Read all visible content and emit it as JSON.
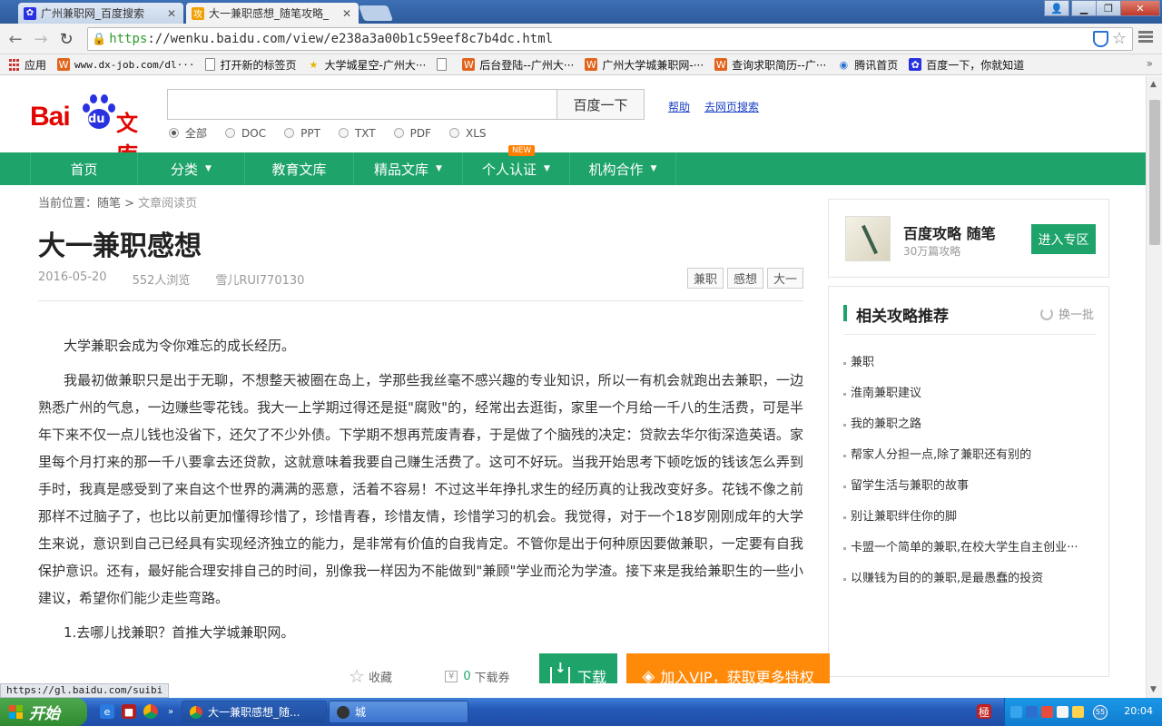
{
  "browser": {
    "tabs": [
      {
        "title": "广州兼职网_百度搜索",
        "icon": "baidu-paw-icon"
      },
      {
        "title": "大一兼职感想_随笔攻略_",
        "icon": "baidu-wenku-icon"
      }
    ],
    "url_scheme": "https",
    "url_rest": "://wenku.baidu.com/view/e238a3a00b1c59eef8c7b4dc.html",
    "bookmarks": [
      {
        "label": "应用",
        "icon": "apps-icon"
      },
      {
        "label": "www.dx-job.com/dl···",
        "icon": "dxjob-icon"
      },
      {
        "label": "打开新的标签页",
        "icon": "page-icon"
      },
      {
        "label": "大学城星空-广州大···",
        "icon": "star-icon"
      },
      {
        "label": "",
        "icon": "page-icon"
      },
      {
        "label": "后台登陆--广州大···",
        "icon": "dxjob-icon"
      },
      {
        "label": "广州大学城兼职网-···",
        "icon": "dxjob-icon"
      },
      {
        "label": "查询求职简历--广···",
        "icon": "dxjob-icon"
      },
      {
        "label": "腾讯首页",
        "icon": "qq-icon"
      },
      {
        "label": "百度一下，你就知道",
        "icon": "baidu-icon"
      }
    ],
    "status_url": "https://gl.baidu.com/suibi"
  },
  "header": {
    "logo_text_bai": "Bai",
    "logo_text_du": "du",
    "logo_text_wenku": "文库",
    "search_button": "百度一下",
    "help_link": "帮助",
    "web_search_link": "去网页搜索",
    "file_types": [
      {
        "label": "全部",
        "selected": true
      },
      {
        "label": "DOC",
        "selected": false
      },
      {
        "label": "PPT",
        "selected": false
      },
      {
        "label": "TXT",
        "selected": false
      },
      {
        "label": "PDF",
        "selected": false
      },
      {
        "label": "XLS",
        "selected": false
      }
    ]
  },
  "green_nav": {
    "items": [
      {
        "label": "首页",
        "dropdown": false
      },
      {
        "label": "分类",
        "dropdown": true
      },
      {
        "label": "教育文库",
        "dropdown": false
      },
      {
        "label": "精品文库",
        "dropdown": true
      },
      {
        "label": "个人认证",
        "dropdown": true
      },
      {
        "label": "机构合作",
        "dropdown": true
      }
    ],
    "new_badge": "NEW"
  },
  "article": {
    "breadcrumb_prefix": "当前位置：随笔 >",
    "breadcrumb_current": "文章阅读页",
    "title": "大一兼职感想",
    "date": "2016-05-20",
    "views": "552人浏览",
    "author": "雪儿RUI770130",
    "tags": [
      "兼职",
      "感想",
      "大一"
    ],
    "paragraphs": [
      "大学兼职会成为令你难忘的成长经历。",
      "我最初做兼职只是出于无聊，不想整天被圈在岛上，学那些我丝毫不感兴趣的专业知识，所以一有机会就跑出去兼职，一边熟悉广州的气息，一边赚些零花钱。我大一上学期过得还是挺\"腐败\"的，经常出去逛街，家里一个月给一千八的生活费，可是半年下来不仅一点儿钱也没省下，还欠了不少外债。下学期不想再荒废青春，于是做了个脑残的决定：贷款去华尔街深造英语。家里每个月打来的那一千八要拿去还贷款，这就意味着我要自己赚生活费了。这可不好玩。当我开始思考下顿吃饭的钱该怎么弄到手时，我真是感受到了来自这个世界的满满的恶意，活着不容易！不过这半年挣扎求生的经历真的让我改变好多。花钱不像之前那样不过脑子了，也比以前更加懂得珍惜了，珍惜青春，珍惜友情，珍惜学习的机会。我觉得，对于一个18岁刚刚成年的大学生来说，意识到自己已经具有实现经济独立的能力，是非常有价值的自我肯定。不管你是出于何种原因要做兼职，一定要有自我保护意识。还有，最好能合理安排自己的时间，别像我一样因为不能做到\"兼顾\"学业而沦为学渣。接下来是我给兼职生的一些小建议，希望你们能少走些弯路。",
      "1.去哪儿找兼职？首推大学城兼职网。"
    ]
  },
  "sidebar": {
    "zone_name": "百度攻略  随笔",
    "zone_sub": "30万篇攻略",
    "zone_button": "进入专区",
    "rec_title": "相关攻略推荐",
    "rec_refresh": "换一批",
    "rec_items": [
      "兼职",
      "淮南兼职建议",
      "我的兼职之路",
      "帮家人分担一点,除了兼职还有别的",
      "留学生活与兼职的故事",
      "别让兼职绊住你的脚",
      "卡盟一个简单的兼职,在校大学生自主创业···",
      "以赚钱为目的的兼职,是最愚蠢的投资"
    ]
  },
  "bottom_bar": {
    "favorite": "收藏",
    "coupon_count": "0",
    "coupon_label": "下载券",
    "download": "下载",
    "vip": "加入VIP，获取更多特权"
  },
  "taskbar": {
    "start": "开始",
    "tasks": [
      {
        "label": "大一兼职感想_随...",
        "icon": "chrome-icon"
      },
      {
        "label": "城",
        "icon": "app-icon"
      }
    ],
    "tray_badge": "55",
    "clock": "20:04"
  },
  "colors": {
    "baidu_red": "#e10601",
    "baidu_blue": "#2932e1",
    "wenku_green": "#1ea36a",
    "vip_orange": "#ff8a0a"
  }
}
